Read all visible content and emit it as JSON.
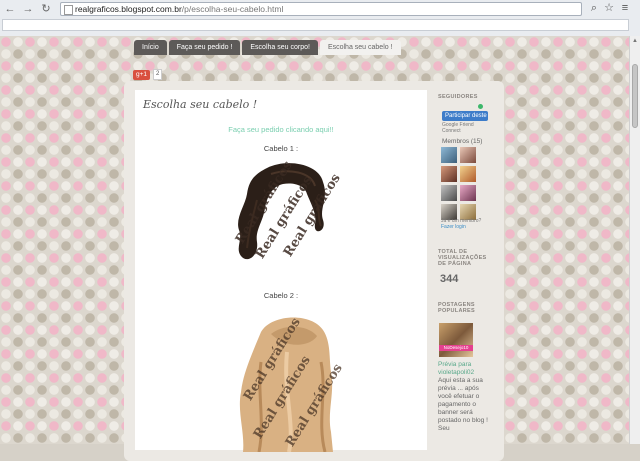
{
  "browser": {
    "url_host": "realgraficos.blogspot.com.br",
    "url_path": "/p/escolha-seu-cabelo.html",
    "icons": [
      "back-arrow",
      "forward-arrow",
      "refresh",
      "search",
      "star",
      "menu"
    ]
  },
  "nav_tabs": [
    "Início",
    "Faça seu pedido !",
    "Escolha seu corpo!",
    "Escolha seu cabelo !"
  ],
  "gplus": {
    "label": "g+1",
    "count": "2"
  },
  "post": {
    "title": "Escolha seu cabelo !",
    "link_text": "Faça seu pedido clicando aqui!!",
    "hair1_label": "Cabelo 1 :",
    "hair2_label": "Cabelo 2 :",
    "watermark": "Real gráficos"
  },
  "sidebar": {
    "followers_heading": "SEGUIDORES",
    "follow_button": "Participar deste site",
    "gfc_text": "Google Friend Connect",
    "members_label": "Membros (15)",
    "already_member": "Já é um membro?",
    "login_link": "Fazer login",
    "views_heading": "TOTAL DE VISUALIZAÇÕES DE PÁGINA",
    "views_count": "344",
    "popular_heading": "POSTAGENS POPULARES",
    "popular_img_tag": "NoDesejo10",
    "popular_title": "Prévia para violetapoli02",
    "popular_text": "Aqui esta a sua prévia ... após você efetuar o pagamento o banner será postado no blog ! Seu"
  },
  "colors": {
    "tab_bg": "#5d5a58",
    "link": "#7bcfb0",
    "follow_button": "#3d7cc9"
  }
}
